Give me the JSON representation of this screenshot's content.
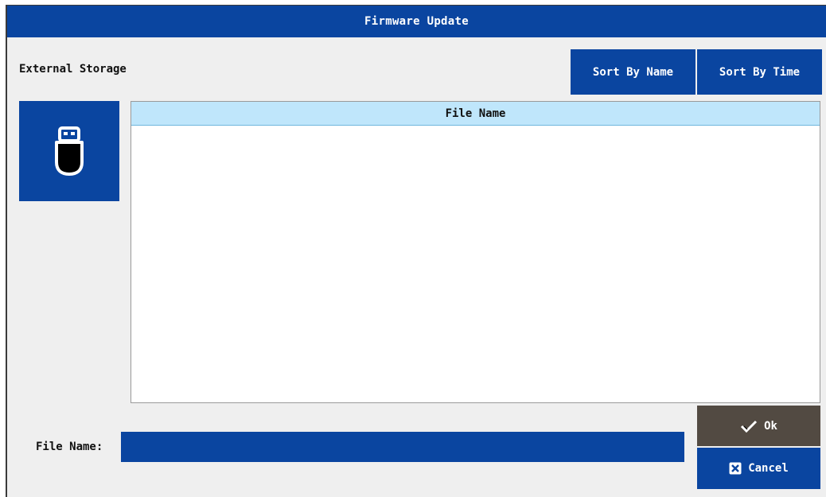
{
  "window": {
    "title": "Firmware Update"
  },
  "storage": {
    "label": "External Storage",
    "icon": "usb-drive-icon"
  },
  "sort": {
    "by_name_label": "Sort By Name",
    "by_time_label": "Sort By Time"
  },
  "file_list": {
    "columns": [
      "File Name"
    ],
    "rows": []
  },
  "file_name_field": {
    "label": "File Name:",
    "value": ""
  },
  "actions": {
    "ok_label": "Ok",
    "ok_icon": "check-icon",
    "cancel_label": "Cancel",
    "cancel_icon": "close-icon"
  },
  "colors": {
    "primary": "#0a45a0",
    "ok_button": "#524a42",
    "list_header": "#bfe6fb",
    "background": "#efefef"
  }
}
